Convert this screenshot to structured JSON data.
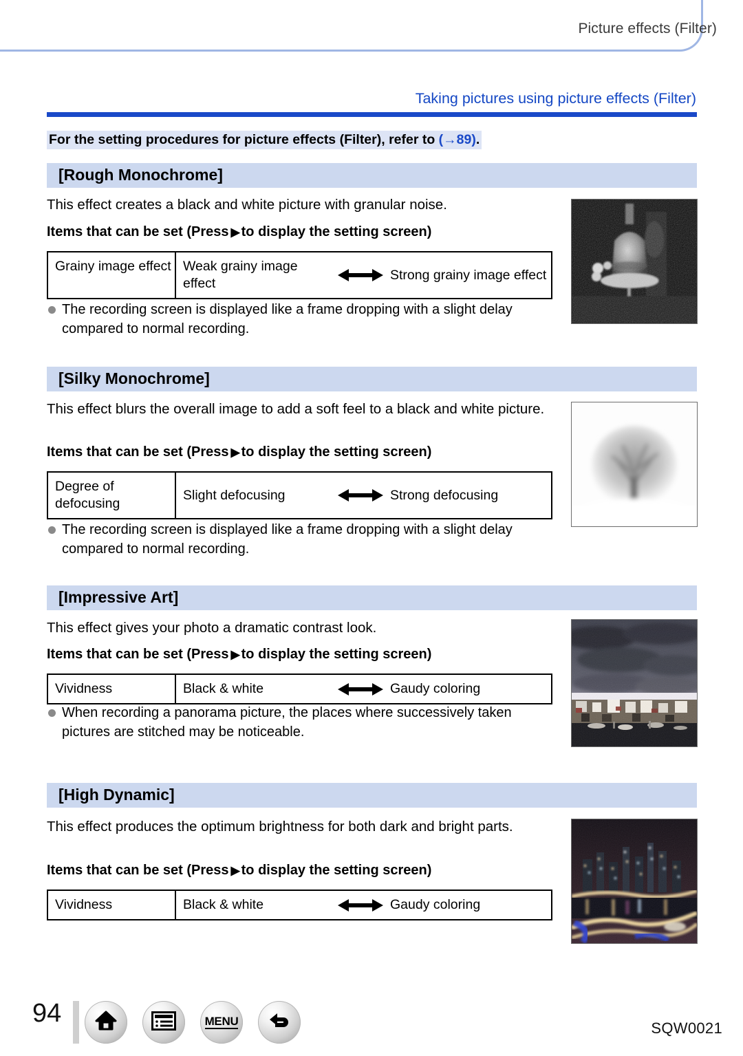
{
  "header": {
    "running_title": "Picture effects (Filter)"
  },
  "chapter": {
    "title": "Taking pictures using picture effects  (Filter)",
    "intro_prefix": "For the setting procedures for picture effects (Filter), refer to ",
    "intro_ref": "(→89)",
    "intro_suffix": "."
  },
  "common": {
    "items_label_prefix": "Items that can be set (Press",
    "items_label_arrow": "▶",
    "items_label_suffix": "to display the setting screen)"
  },
  "effects": [
    {
      "name": "[Rough Monochrome]",
      "description": "This effect creates a black and white picture with granular noise.",
      "table": {
        "item": "Grainy image effect",
        "low": "Weak grainy image effect",
        "high": "Strong grainy image effect"
      },
      "note": "The recording screen is displayed like a frame dropping with a slight delay compared to normal recording.",
      "sample_alt": "rough-monochrome-bell-sample"
    },
    {
      "name": "[Silky Monochrome]",
      "description": "This effect blurs the overall image to add a soft feel to a black and white picture.",
      "table": {
        "item": "Degree of defocusing",
        "low": "Slight defocusing",
        "high": "Strong defocusing"
      },
      "note": "The recording screen is displayed like a frame dropping with a slight delay compared to normal recording.",
      "sample_alt": "silky-monochrome-tree-sample"
    },
    {
      "name": "[Impressive Art]",
      "description": "This effect gives your photo a dramatic contrast look.",
      "table": {
        "item": "Vividness",
        "low": "Black & white",
        "high": "Gaudy coloring"
      },
      "note": "When recording a panorama picture, the places where successively taken pictures are stitched may be noticeable.",
      "sample_alt": "impressive-art-harbor-sample"
    },
    {
      "name": "[High Dynamic]",
      "description": "This effect produces the optimum brightness for both dark and bright parts.",
      "table": {
        "item": "Vividness",
        "low": "Black & white",
        "high": "Gaudy coloring"
      },
      "note": "",
      "sample_alt": "high-dynamic-night-city-sample"
    }
  ],
  "footer": {
    "page_number": "94",
    "nav": [
      {
        "name": "home-icon",
        "label": ""
      },
      {
        "name": "contents-list-icon",
        "label": ""
      },
      {
        "name": "menu-button",
        "label": "MENU"
      },
      {
        "name": "back-arrow-icon",
        "label": ""
      }
    ],
    "document_code": "SQW0021"
  },
  "colors": {
    "rule_blue": "#1a49c8",
    "heading_band": "#ccd8ef",
    "tab_border": "#9fb6e4",
    "highlight": "#dde4f5"
  }
}
